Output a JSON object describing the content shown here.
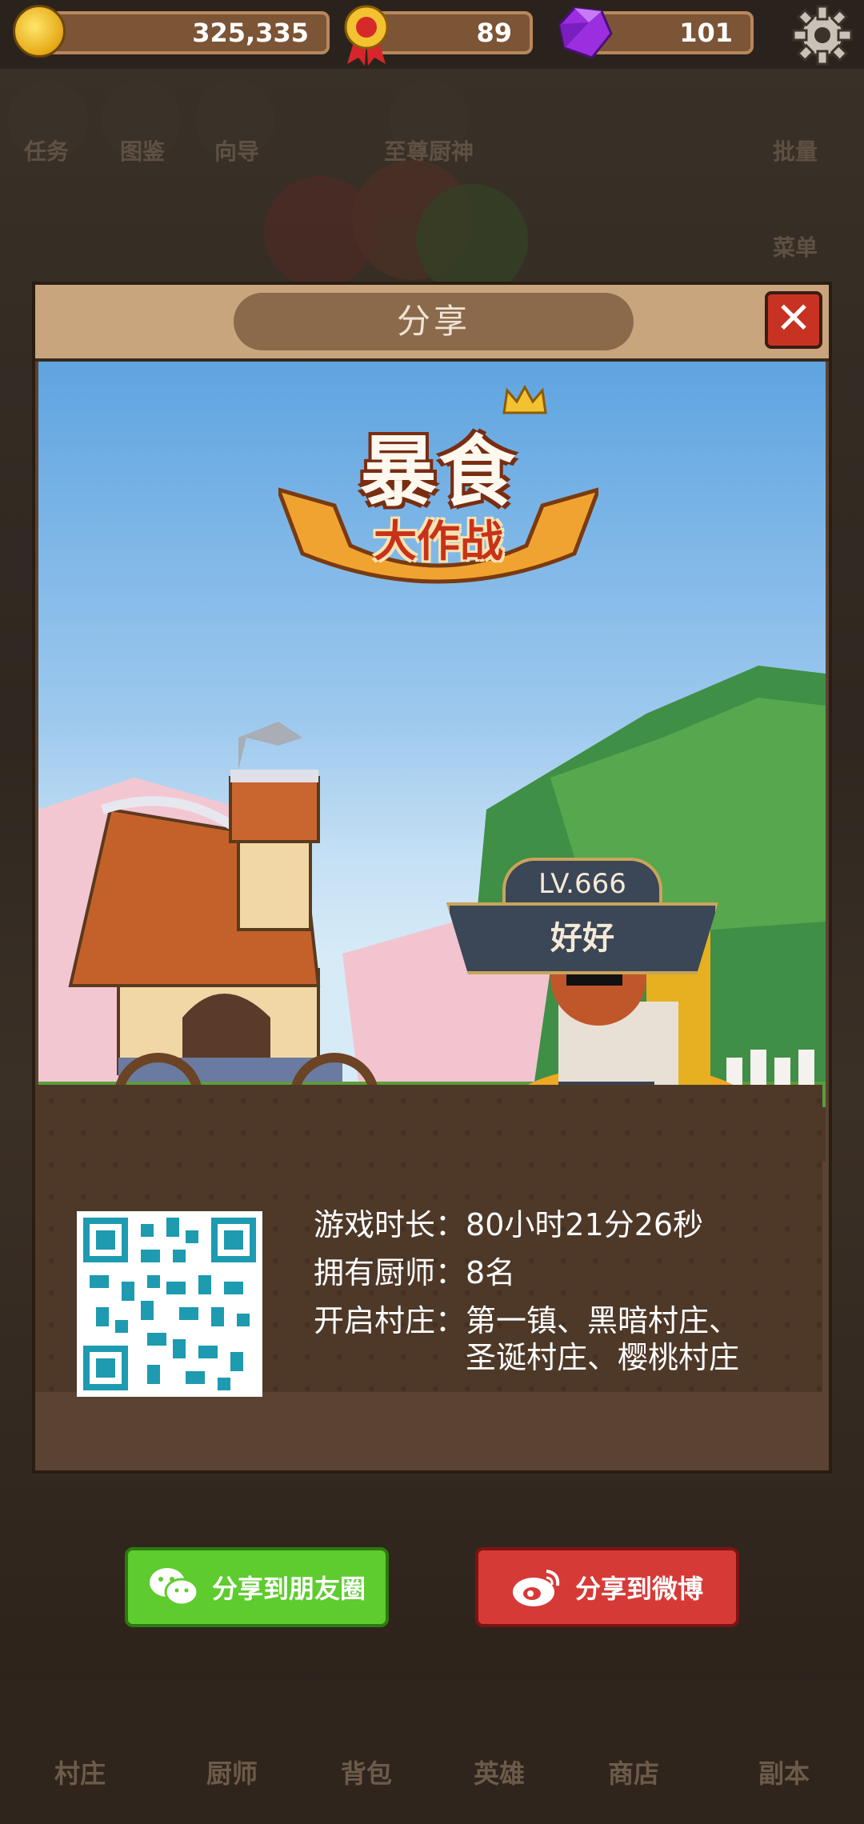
{
  "currency": {
    "gold": "325,335",
    "medals": "89",
    "gems": "101"
  },
  "background_menu": {
    "tasks": "任务",
    "catalog": "图鉴",
    "guide": "向导",
    "chef_god": "至尊厨神",
    "batch": "批量",
    "menu": "菜单"
  },
  "dialog": {
    "title": "分享",
    "close_symbol": "✕",
    "logo_main": "暴食",
    "logo_sub": "大作战",
    "level": "LV.666",
    "player_name": "好好",
    "stats": [
      {
        "label": "游戏时长：",
        "value": "80小时21分26秒"
      },
      {
        "label": "拥有厨师：",
        "value": "8名"
      },
      {
        "label": "开启村庄：",
        "value": "第一镇、黑暗村庄、\n圣诞村庄、樱桃村庄"
      }
    ]
  },
  "share": {
    "wechat_label": "分享到朋友圈",
    "weibo_label": "分享到微博"
  },
  "bottom_nav": {
    "village": "村庄",
    "chef": "厨师",
    "bag": "背包",
    "hero": "英雄",
    "shop": "商店",
    "dungeon": "副本"
  },
  "colors": {
    "wechat_green": "#5ecb2f",
    "weibo_red": "#d63a37",
    "close_red": "#c73222"
  }
}
